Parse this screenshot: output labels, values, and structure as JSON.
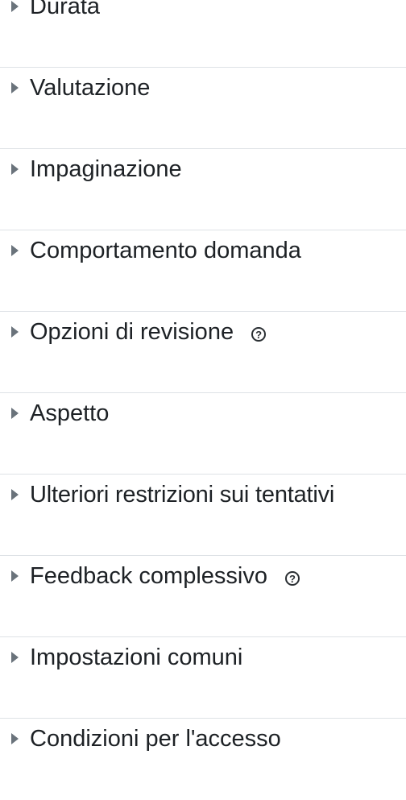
{
  "sections": [
    {
      "label": "Durata",
      "help": false
    },
    {
      "label": "Valutazione",
      "help": false
    },
    {
      "label": "Impaginazione",
      "help": false
    },
    {
      "label": "Comportamento domanda",
      "help": false
    },
    {
      "label": "Opzioni di revisione",
      "help": true
    },
    {
      "label": "Aspetto",
      "help": false
    },
    {
      "label": "Ulteriori restrizioni sui tentativi",
      "help": false
    },
    {
      "label": "Feedback complessivo",
      "help": true
    },
    {
      "label": "Impostazioni comuni",
      "help": false
    },
    {
      "label": "Condizioni per l'accesso",
      "help": false
    }
  ],
  "icons": {
    "caret": "caret-right-icon",
    "help": "question-circle-icon",
    "help_glyph": "?"
  },
  "colors": {
    "text": "#1d2125",
    "caret": "#6a737b",
    "divider": "#dee2e6"
  }
}
